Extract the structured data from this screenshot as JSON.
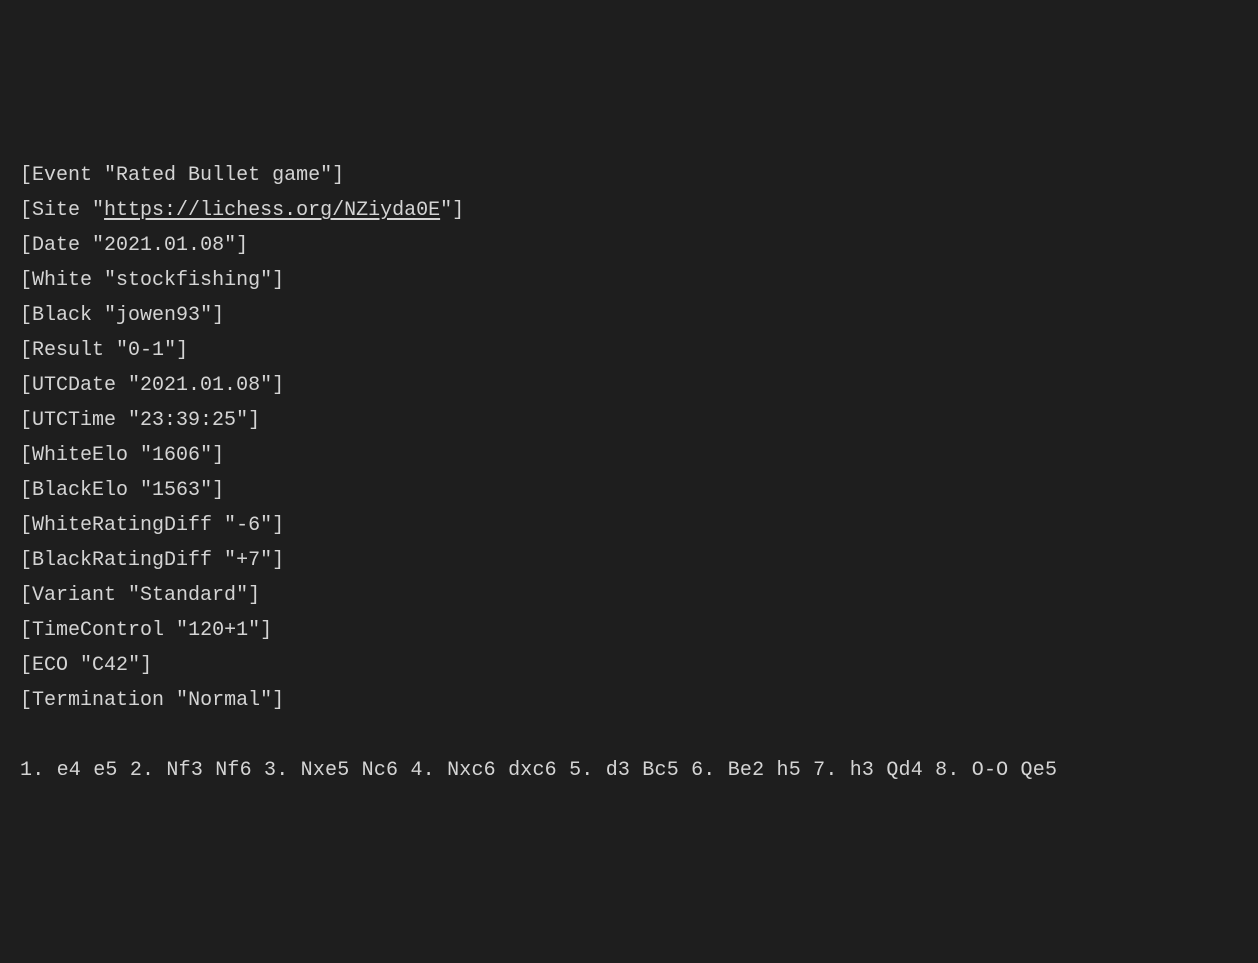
{
  "pgn": {
    "headers": [
      {
        "key": "Event",
        "value": "Rated Bullet game"
      },
      {
        "key": "Site",
        "value": "https://lichess.org/NZiyda0E",
        "link": true
      },
      {
        "key": "Date",
        "value": "2021.01.08"
      },
      {
        "key": "White",
        "value": "stockfishing"
      },
      {
        "key": "Black",
        "value": "jowen93"
      },
      {
        "key": "Result",
        "value": "0-1"
      },
      {
        "key": "UTCDate",
        "value": "2021.01.08"
      },
      {
        "key": "UTCTime",
        "value": "23:39:25"
      },
      {
        "key": "WhiteElo",
        "value": "1606"
      },
      {
        "key": "BlackElo",
        "value": "1563"
      },
      {
        "key": "WhiteRatingDiff",
        "value": "-6"
      },
      {
        "key": "BlackRatingDiff",
        "value": "+7"
      },
      {
        "key": "Variant",
        "value": "Standard"
      },
      {
        "key": "TimeControl",
        "value": "120+1"
      },
      {
        "key": "ECO",
        "value": "C42"
      },
      {
        "key": "Termination",
        "value": "Normal"
      }
    ],
    "moves": "1. e4 e5 2. Nf3 Nf6 3. Nxe5 Nc6 4. Nxc6 dxc6 5. d3 Bc5 6. Be2 h5 7. h3 Qd4 8. O-O Qe5"
  }
}
